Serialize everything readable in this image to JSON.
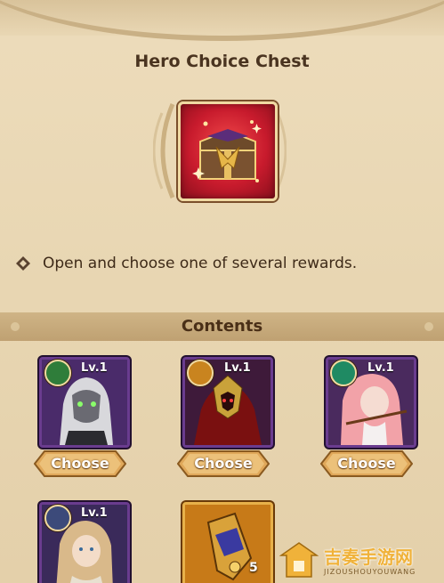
{
  "title": "Hero Choice Chest",
  "description": "Open and choose one of several rewards.",
  "contents_label": "Contents",
  "items": [
    {
      "level": "Lv.1",
      "choose_label": "Choose",
      "faction_color": "#2f7d3a",
      "faction_icon": "green-leaf-faction-icon"
    },
    {
      "level": "Lv.1",
      "choose_label": "Choose",
      "faction_color": "#c9841f",
      "faction_icon": "sun-faction-icon"
    },
    {
      "level": "Lv.1",
      "choose_label": "Choose",
      "faction_color": "#1f8a63",
      "faction_icon": "forest-faction-icon"
    },
    {
      "level": "Lv.1",
      "choose_label": "",
      "faction_color": "#3c4a7a",
      "faction_icon": "star-faction-icon"
    }
  ],
  "gear_item": {
    "count": "5",
    "icon": "gauntlet-icon"
  },
  "watermark": {
    "cn": "吉奏手游网",
    "en": "JIZOUSHOUYOUWANG"
  },
  "colors": {
    "chest_bg": "#c81b2d",
    "card_border": "#6a3c8f",
    "button": "#e0a85a"
  }
}
